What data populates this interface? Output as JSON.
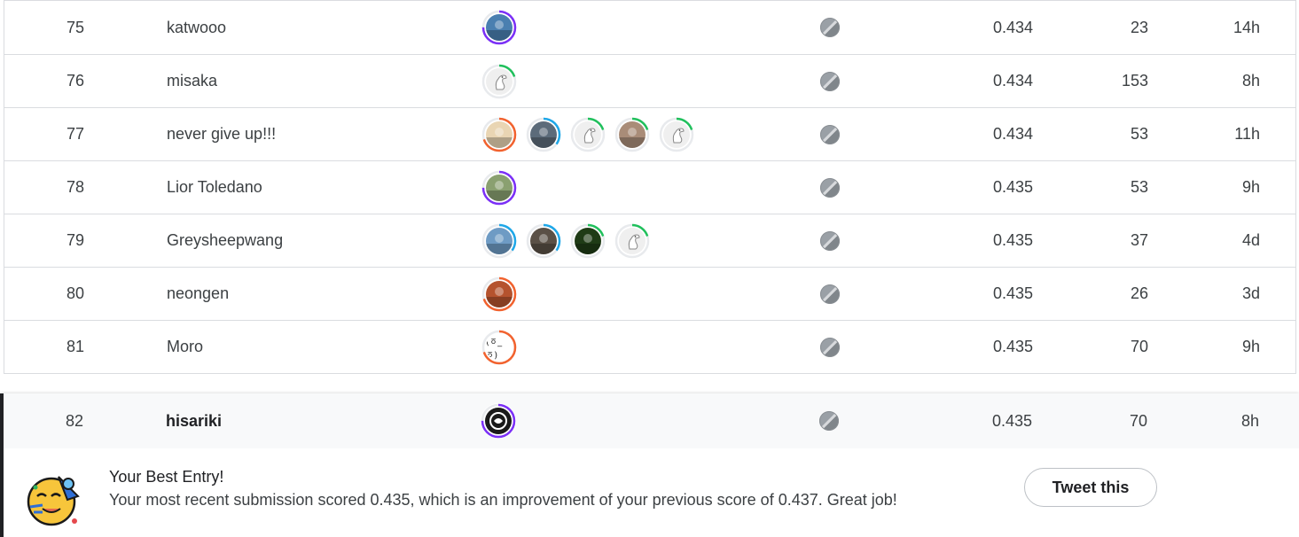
{
  "rows": [
    {
      "rank": "75",
      "name": "katwooo",
      "score": "0.434",
      "entries": "23",
      "last": "14h",
      "members": [
        {
          "ring": "#7b2ff7",
          "pct": 0.75,
          "bg": "#4a7fb0",
          "icon": "photo-landscape"
        }
      ]
    },
    {
      "rank": "76",
      "name": "misaka",
      "score": "0.434",
      "entries": "153",
      "last": "8h",
      "members": [
        {
          "ring": "#20c05c",
          "pct": 0.2,
          "bg": "#efefef",
          "icon": "goose-default"
        }
      ]
    },
    {
      "rank": "77",
      "name": "never give up!!!",
      "score": "0.434",
      "entries": "53",
      "last": "11h",
      "members": [
        {
          "ring": "#f2622e",
          "pct": 0.7,
          "bg": "#e9d5b3",
          "icon": "photo-sketch"
        },
        {
          "ring": "#1ea7e8",
          "pct": 0.35,
          "bg": "#5c6b7a",
          "icon": "photo-person"
        },
        {
          "ring": "#20c05c",
          "pct": 0.2,
          "bg": "#efefef",
          "icon": "goose-default"
        },
        {
          "ring": "#20c05c",
          "pct": 0.2,
          "bg": "#a98c78",
          "icon": "photo-building"
        },
        {
          "ring": "#20c05c",
          "pct": 0.2,
          "bg": "#efefef",
          "icon": "goose-default"
        }
      ]
    },
    {
      "rank": "78",
      "name": "Lior Toledano",
      "score": "0.435",
      "entries": "53",
      "last": "9h",
      "members": [
        {
          "ring": "#7b2ff7",
          "pct": 0.75,
          "bg": "#8aa070",
          "icon": "photo-person"
        }
      ]
    },
    {
      "rank": "79",
      "name": "Greysheepwang",
      "score": "0.435",
      "entries": "37",
      "last": "4d",
      "members": [
        {
          "ring": "#1ea7e8",
          "pct": 0.35,
          "bg": "#6e9bc4",
          "icon": "photo-sea"
        },
        {
          "ring": "#1ea7e8",
          "pct": 0.35,
          "bg": "#5a5046",
          "icon": "photo-rock"
        },
        {
          "ring": "#20c05c",
          "pct": 0.2,
          "bg": "#1f3b16",
          "icon": "photo-plant"
        },
        {
          "ring": "#20c05c",
          "pct": 0.2,
          "bg": "#efefef",
          "icon": "goose-default"
        }
      ]
    },
    {
      "rank": "80",
      "name": "neongen",
      "score": "0.435",
      "entries": "26",
      "last": "3d",
      "members": [
        {
          "ring": "#f2622e",
          "pct": 0.7,
          "bg": "#b5532e",
          "icon": "photo-art"
        }
      ]
    },
    {
      "rank": "81",
      "name": "Moro",
      "score": "0.435",
      "entries": "70",
      "last": "9h",
      "members": [
        {
          "ring": "#f2622e",
          "pct": 0.7,
          "bg": "#ffffff",
          "icon": "face-text"
        }
      ]
    }
  ],
  "me": {
    "rank": "82",
    "name": "hisariki",
    "score": "0.435",
    "entries": "70",
    "last": "8h",
    "members": [
      {
        "ring": "#7b2ff7",
        "pct": 0.75,
        "bg": "#1a1a1a",
        "icon": "photo-dark"
      }
    ]
  },
  "banner": {
    "title": "Your Best Entry!",
    "message": "Your most recent submission scored 0.435, which is an improvement of your previous score of 0.437. Great job!",
    "tweet_label": "Tweet this",
    "emoji_icon": "party-face-icon"
  },
  "face_text": "(ㆆ_ㆆ)"
}
